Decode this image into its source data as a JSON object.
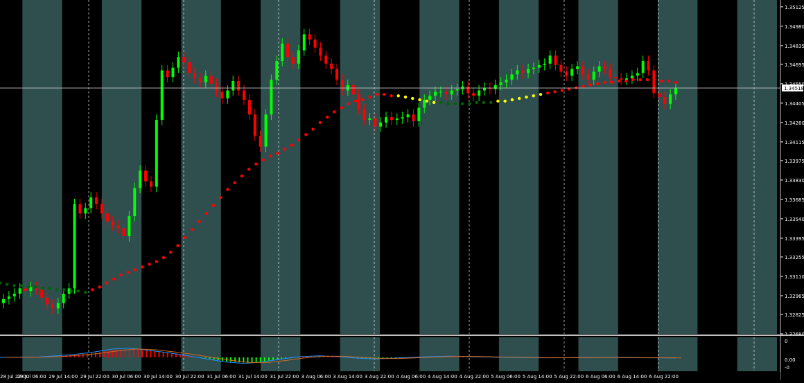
{
  "colors": {
    "background": "#000000",
    "band": "#2f4f4f",
    "axis_text": "#ffffff",
    "grid": "#ffffff",
    "bull_candle": "#00ff00",
    "bear_candle": "#ff0000",
    "trend_up_dots": "#ff0000",
    "trend_down_dots": "#006400",
    "trend_flip_dots": "#ffff00",
    "macd_line": "#1e90ff",
    "signal_line": "#d2691e",
    "hist_pos": "#ff0000",
    "hist_neg": "#00ff00",
    "price_line": "#c0c0c0",
    "price_box_bg": "#ffffff",
    "price_box_text": "#000000"
  },
  "chart_data": {
    "type": "candlestick",
    "title": "",
    "grid": true,
    "price_axis_labels": [
      "1.35125",
      "1.34980",
      "1.34835",
      "1.34695",
      "1.34550",
      "1.34405",
      "1.34260",
      "1.34115",
      "1.33975",
      "1.33830",
      "1.33685",
      "1.33540",
      "1.33395",
      "1.33255",
      "1.33110",
      "1.32965",
      "1.32825",
      "1.32680"
    ],
    "price_range": [
      1.3268,
      1.35176
    ],
    "current_price": "1.34518",
    "time_axis_labels": [
      "28 Jul 22:00",
      "29 Jul 06:00",
      "29 Jul 14:00",
      "29 Jul 22:00",
      "30 Jul 06:00",
      "30 Jul 14:00",
      "30 Jul 22:00",
      "31 Jul 06:00",
      "31 Jul 14:00",
      "31 Jul 22:00",
      "3 Aug 06:00",
      "3 Aug 14:00",
      "3 Aug 22:00",
      "4 Aug 06:00",
      "4 Aug 14:00",
      "4 Aug 22:00",
      "5 Aug 06:00",
      "5 Aug 14:00",
      "5 Aug 22:00",
      "6 Aug 06:00",
      "6 Aug 14:00",
      "6 Aug 22:00"
    ],
    "candles_close": [
      1.3294,
      1.3296,
      1.3298,
      1.3302,
      1.33,
      1.3303,
      1.3301,
      1.3295,
      1.329,
      1.3287,
      1.3291,
      1.3298,
      1.3302,
      1.3365,
      1.3358,
      1.3362,
      1.337,
      1.3365,
      1.3358,
      1.3352,
      1.3349,
      1.3347,
      1.3341,
      1.3356,
      1.3377,
      1.339,
      1.3382,
      1.3378,
      1.3428,
      1.3465,
      1.346,
      1.3467,
      1.3475,
      1.3471,
      1.3463,
      1.3459,
      1.3456,
      1.3461,
      1.3455,
      1.3449,
      1.3444,
      1.345,
      1.3457,
      1.345,
      1.3443,
      1.3432,
      1.3416,
      1.3408,
      1.3432,
      1.3458,
      1.3472,
      1.3485,
      1.3475,
      1.347,
      1.348,
      1.3492,
      1.3488,
      1.3482,
      1.3476,
      1.347,
      1.3466,
      1.3458,
      1.345,
      1.3454,
      1.3447,
      1.3436,
      1.3428,
      1.3429,
      1.3423,
      1.3426,
      1.343,
      1.3428,
      1.3429,
      1.343,
      1.3432,
      1.3427,
      1.3437,
      1.3443,
      1.3446,
      1.3449,
      1.3449,
      1.3447,
      1.345,
      1.3451,
      1.3453,
      1.3448,
      1.3446,
      1.345,
      1.3452,
      1.3451,
      1.3454,
      1.3456,
      1.3458,
      1.3462,
      1.3465,
      1.3463,
      1.3466,
      1.3467,
      1.3469,
      1.347,
      1.3476,
      1.3469,
      1.3464,
      1.3461,
      1.3466,
      1.3468,
      1.3462,
      1.3458,
      1.3464,
      1.3468,
      1.3466,
      1.346,
      1.3459,
      1.3458,
      1.3459,
      1.3461,
      1.3463,
      1.3472,
      1.3465,
      1.3448,
      1.3445,
      1.344,
      1.3447,
      1.3452
    ],
    "trend_dots": [
      1.3306,
      1.3305,
      1.3304,
      1.3304,
      1.3303,
      1.3303,
      1.3302,
      1.3302,
      1.3301,
      1.3301,
      1.33,
      1.33,
      1.3299,
      1.3301,
      1.3303,
      1.3306,
      1.3309,
      1.3312,
      1.3314,
      1.3316,
      1.3318,
      1.332,
      1.3322,
      1.3325,
      1.3329,
      1.3334,
      1.334,
      1.3346,
      1.3352,
      1.3358,
      1.3364,
      1.337,
      1.3376,
      1.3381,
      1.3386,
      1.3391,
      1.3395,
      1.3398,
      1.3401,
      1.3403,
      1.3406,
      1.3409,
      1.3413,
      1.3417,
      1.3421,
      1.3426,
      1.343,
      1.3434,
      1.3437,
      1.344,
      1.3442,
      1.3443,
      1.3445,
      1.3447,
      1.3447,
      1.3446,
      1.3446,
      1.3445,
      1.3444,
      1.3443,
      1.3442,
      1.3441,
      1.3441,
      1.344,
      1.344,
      1.344,
      1.344,
      1.3441,
      1.3441,
      1.3441,
      1.3442,
      1.3442,
      1.3443,
      1.3444,
      1.3445,
      1.3446,
      1.3447,
      1.3448,
      1.3449,
      1.345,
      1.3451,
      1.3452,
      1.3453,
      1.3454,
      1.3455,
      1.3456,
      1.3456,
      1.3457,
      1.3457,
      1.3458,
      1.3458,
      1.3458,
      1.3458,
      1.3457,
      1.3457,
      1.3456
    ],
    "trend_flip_points": [
      [
        1.3299,
        "yellow"
      ],
      [
        1.3446,
        "yellow"
      ],
      [
        1.3441,
        "yellow"
      ]
    ],
    "oscillator_axis_labels": [
      "0",
      "0.00",
      "-0"
    ],
    "macd_values": [
      0.0,
      0.01,
      0.02,
      0.1,
      0.2,
      0.35,
      0.55,
      0.6,
      0.45,
      0.3,
      0.1,
      -0.1,
      -0.3,
      -0.4,
      -0.3,
      -0.1,
      0.05,
      0.1,
      0.05,
      -0.05,
      -0.1,
      -0.05,
      0.0,
      0.05,
      0.08,
      0.05,
      0.02,
      0.0,
      -0.02,
      -0.03,
      -0.02,
      -0.01,
      0.0,
      -0.01,
      -0.02,
      -0.03,
      -0.04
    ]
  }
}
